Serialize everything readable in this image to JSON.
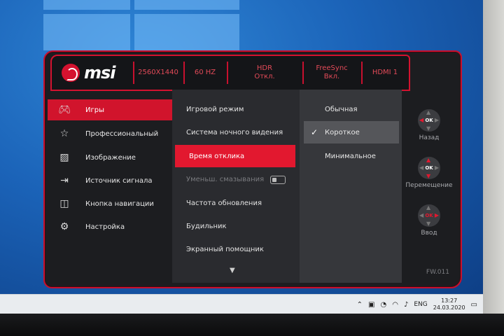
{
  "osd": {
    "brand": "msi",
    "header": {
      "resolution": "2560X1440",
      "refresh": "60 HZ",
      "hdr_line1": "HDR",
      "hdr_line2": "Откл.",
      "freesync_line1": "FreeSync",
      "freesync_line2": "Вкл.",
      "input": "HDMI 1"
    },
    "main_menu": [
      {
        "label": "Игры",
        "icon": "gamepad-icon",
        "active": true
      },
      {
        "label": "Профессиональный",
        "icon": "star-icon",
        "active": false
      },
      {
        "label": "Изображение",
        "icon": "image-icon",
        "active": false
      },
      {
        "label": "Источник сигнала",
        "icon": "input-source-icon",
        "active": false
      },
      {
        "label": "Кнопка навигации",
        "icon": "nav-key-icon",
        "active": false
      },
      {
        "label": "Настройка",
        "icon": "gear-icon",
        "active": false
      }
    ],
    "sub_menu": [
      {
        "label": "Игровой режим",
        "state": "normal"
      },
      {
        "label": "Система ночного видения",
        "state": "normal"
      },
      {
        "label": "Время отклика",
        "state": "active"
      },
      {
        "label": "Уменьш. смазывания",
        "state": "disabled"
      },
      {
        "label": "Частота обновления",
        "state": "normal"
      },
      {
        "label": "Будильник",
        "state": "normal"
      },
      {
        "label": "Экранный помощник",
        "state": "normal"
      }
    ],
    "options": [
      {
        "label": "Обычная",
        "selected": false
      },
      {
        "label": "Короткое",
        "selected": true
      },
      {
        "label": "Минимальное",
        "selected": false
      }
    ],
    "nav_hints": [
      {
        "label": "Назад",
        "ok": "OK"
      },
      {
        "label": "Перемещение",
        "ok": "OK"
      },
      {
        "label": "Ввод",
        "ok": "OK"
      }
    ],
    "firmware": "FW.011"
  },
  "taskbar": {
    "language": "ENG",
    "time": "13:27",
    "date": "24.03.2020"
  },
  "colors": {
    "accent": "#d4122f",
    "osd_bg": "#1c1d20",
    "desktop": "#1b63b8"
  }
}
